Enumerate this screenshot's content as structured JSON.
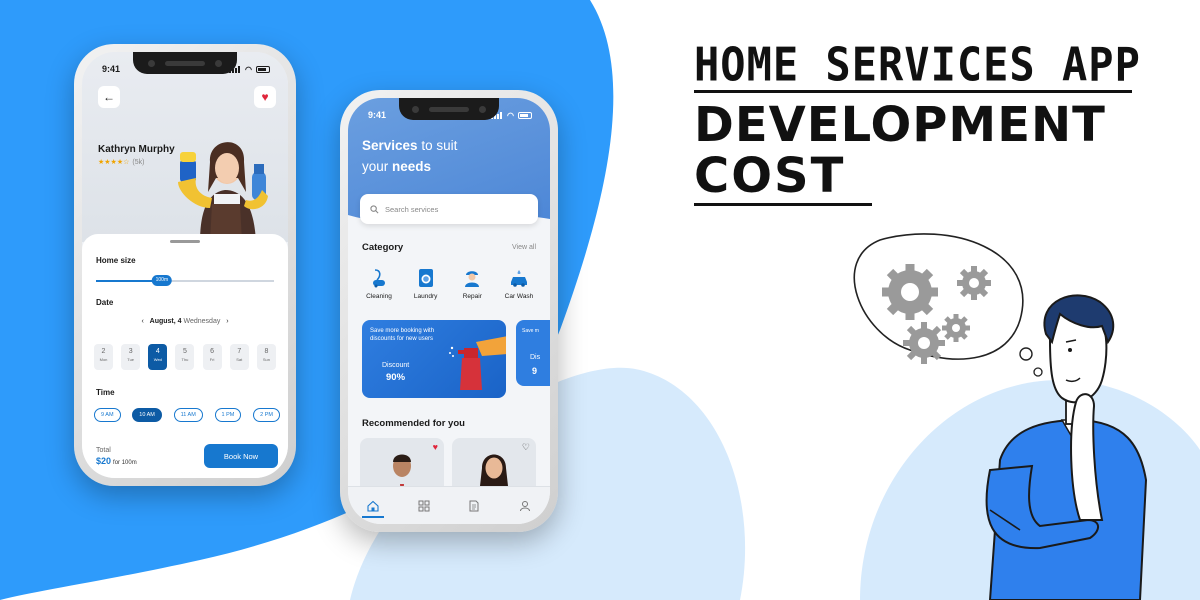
{
  "colors": {
    "accent": "#1778cf",
    "background_blue": "#2e9bfb",
    "light_blue": "#d6eafc",
    "heading": "#111111"
  },
  "heading": {
    "line1": "HOME SERVICES APP",
    "line2": "DEVELOPMENT",
    "line3": "COST"
  },
  "phone1": {
    "time": "9:41",
    "back_icon": "arrow-left-icon",
    "favorite_icon": "heart-icon",
    "worker_name": "Kathryn Murphy",
    "rating_stars": "★★★★☆",
    "rating_count": "(5k)",
    "home_size_label": "Home size",
    "home_size_value": "100m",
    "home_size_fraction": 0.37,
    "date_label": "Date",
    "date_prev": "‹",
    "date_next": "›",
    "date_bold": "August, 4",
    "date_weekday": "Wednesday",
    "days": [
      {
        "num": "2",
        "wd": "Mon"
      },
      {
        "num": "3",
        "wd": "Tue"
      },
      {
        "num": "4",
        "wd": "Wed"
      },
      {
        "num": "5",
        "wd": "Thu"
      },
      {
        "num": "6",
        "wd": "Fri"
      },
      {
        "num": "7",
        "wd": "Sat"
      },
      {
        "num": "8",
        "wd": "Sun"
      }
    ],
    "time_label": "Time",
    "times": [
      "9 AM",
      "10 AM",
      "11 AM",
      "1 PM",
      "2 PM"
    ],
    "total_label": "Total",
    "total_value": "$20",
    "total_unit": "for 100m",
    "book_button": "Book Now"
  },
  "phone2": {
    "time": "9:41",
    "title_part1": "Services",
    "title_part2": " to suit",
    "title_part3": "your ",
    "title_part4": "needs",
    "search_placeholder": "Search services",
    "category_label": "Category",
    "view_all": "View all",
    "categories": [
      {
        "label": "Cleaning",
        "icon": "vacuum-icon"
      },
      {
        "label": "Laundry",
        "icon": "washing-machine-icon"
      },
      {
        "label": "Repair",
        "icon": "repairman-icon"
      },
      {
        "label": "Car Wash",
        "icon": "car-wash-icon"
      }
    ],
    "promo": {
      "text": "Save more booking with discounts for new users",
      "discount_label": "Discount",
      "discount_value": "90%"
    },
    "promo2": {
      "text": "Save m",
      "discount_label": "Dis",
      "discount_value": "9"
    },
    "recommended_label": "Recommended for you",
    "tabs": [
      "home-icon",
      "grid-icon",
      "document-icon",
      "profile-icon"
    ]
  }
}
